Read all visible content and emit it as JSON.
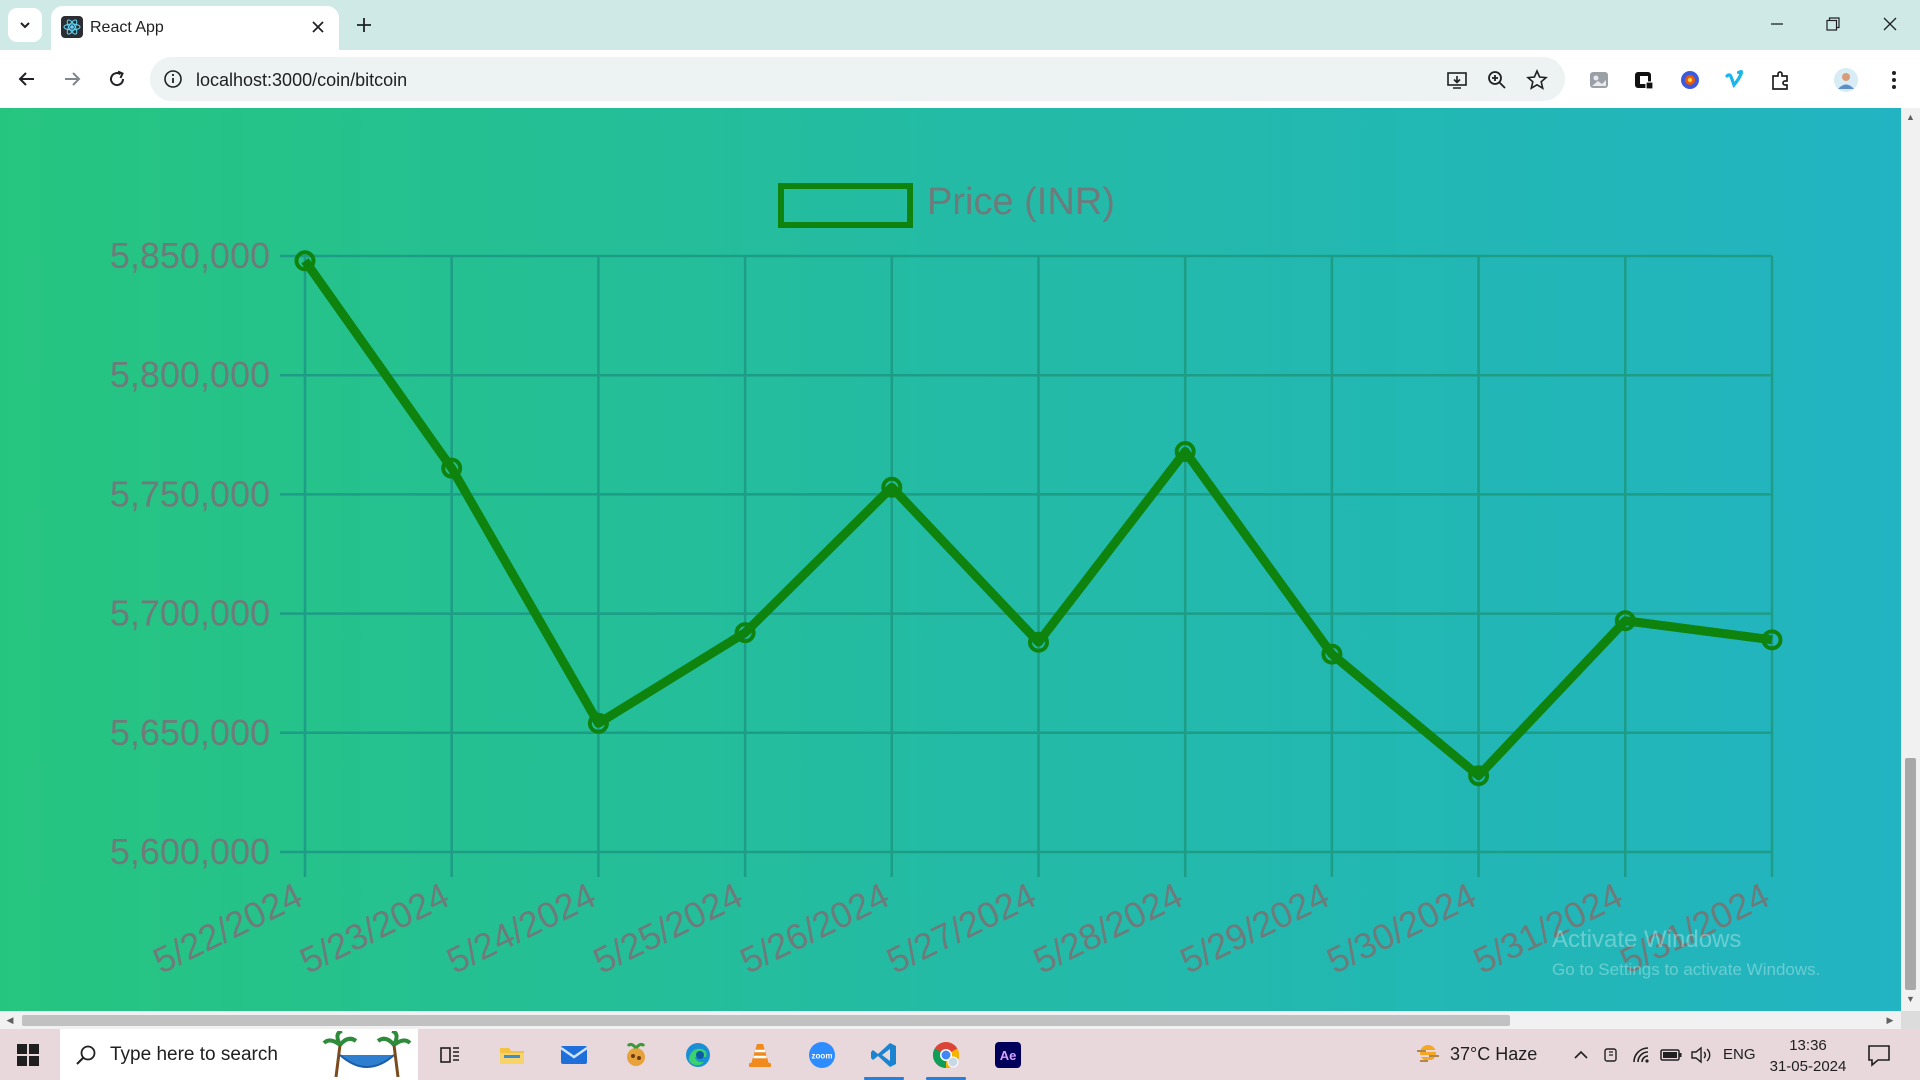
{
  "browser": {
    "tab_title": "React App",
    "url": "localhost:3000/coin/bitcoin"
  },
  "chart_data": {
    "type": "line",
    "x": [
      "5/22/2024",
      "5/23/2024",
      "5/24/2024",
      "5/25/2024",
      "5/26/2024",
      "5/27/2024",
      "5/28/2024",
      "5/29/2024",
      "5/30/2024",
      "5/31/2024",
      "5/31/2024"
    ],
    "series": [
      {
        "name": "Price (INR)",
        "values": [
          5848000,
          5761000,
          5654000,
          5692000,
          5753000,
          5688000,
          5768000,
          5683000,
          5632000,
          5697000,
          5689000
        ]
      }
    ],
    "ylim": [
      5600000,
      5850000
    ],
    "yticks": [
      "5,850,000",
      "5,800,000",
      "5,750,000",
      "5,700,000",
      "5,650,000",
      "5,600,000"
    ],
    "ytick_values": [
      5850000,
      5800000,
      5750000,
      5700000,
      5650000,
      5600000
    ],
    "grid": true,
    "legend": "top-center",
    "colors": {
      "line": "#0e840e",
      "grid": "#1d9c86",
      "text": "#6f7a7a"
    }
  },
  "watermark": {
    "line1": "Activate Windows",
    "line2": "Go to Settings to activate Windows."
  },
  "taskbar": {
    "search_placeholder": "Type here to search",
    "weather": "37°C  Haze",
    "language": "ENG",
    "time": "13:36",
    "date": "31-05-2024",
    "apps": [
      "task-view",
      "file-explorer",
      "mail",
      "game",
      "edge",
      "vlc",
      "zoom",
      "vscode",
      "chrome",
      "after-effects"
    ]
  }
}
